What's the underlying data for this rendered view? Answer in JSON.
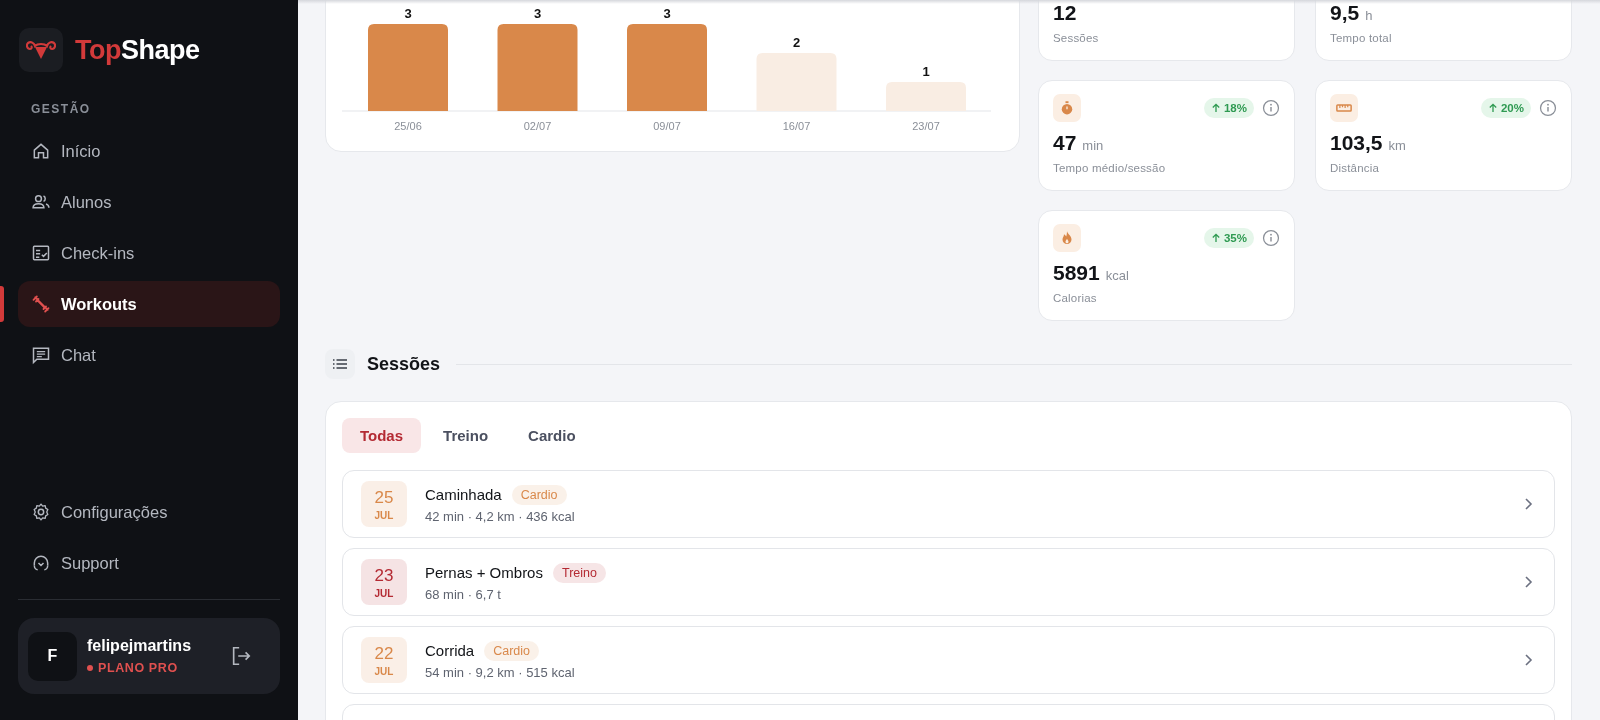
{
  "sidebar": {
    "brand": {
      "accent": "Top",
      "rest": "Shape"
    },
    "section_label": "GESTÃO",
    "items": [
      {
        "label": "Início",
        "selected": false
      },
      {
        "label": "Alunos",
        "selected": false
      },
      {
        "label": "Check-ins",
        "selected": false
      },
      {
        "label": "Workouts",
        "selected": true
      },
      {
        "label": "Chat",
        "selected": false
      }
    ],
    "bottom_items": [
      {
        "label": "Configurações"
      },
      {
        "label": "Support"
      }
    ],
    "user": {
      "initial": "F",
      "name": "felipejmartins",
      "plan": "PLANO PRO"
    }
  },
  "chart": {
    "chart_data": {
      "type": "bar",
      "categories": [
        "25/06",
        "02/07",
        "09/07",
        "16/07",
        "23/07"
      ],
      "data_labels": true,
      "series": [
        {
          "color": "#d9884a",
          "values": [
            3,
            3,
            3,
            null,
            null
          ]
        },
        {
          "color": "#f9ede3",
          "values": [
            null,
            null,
            null,
            2,
            1
          ]
        }
      ]
    }
  },
  "stats": [
    {
      "value": "12",
      "label": "Sessões"
    },
    {
      "value": "9,5",
      "unit": "h",
      "label": "Tempo total"
    },
    {
      "value": "47",
      "unit": "min",
      "label": "Tempo médio/sessão",
      "trend": "18%"
    },
    {
      "value": "103,5",
      "unit": "km",
      "label": "Distância",
      "trend": "20%"
    },
    {
      "value": "5891",
      "unit": "kcal",
      "label": "Calorias",
      "trend": "35%"
    }
  ],
  "sessions": {
    "title": "Sessões",
    "tabs": [
      {
        "label": "Todas",
        "selected": true
      },
      {
        "label": "Treino",
        "selected": false
      },
      {
        "label": "Cardio",
        "selected": false
      }
    ],
    "rows": [
      {
        "day": "25",
        "month": "JUL",
        "title": "Caminhada",
        "tag": "Cardio",
        "color": "#d9884a",
        "details": "42 min · 4,2 km · 436 kcal"
      },
      {
        "day": "23",
        "month": "JUL",
        "title": "Pernas + Ombros",
        "tag": "Treino",
        "color": "#b42a33",
        "details": "68 min · 6,7 t"
      },
      {
        "day": "22",
        "month": "JUL",
        "title": "Corrida",
        "tag": "Cardio",
        "color": "#d9884a",
        "details": "54 min · 9,2 km · 515 kcal"
      }
    ]
  }
}
